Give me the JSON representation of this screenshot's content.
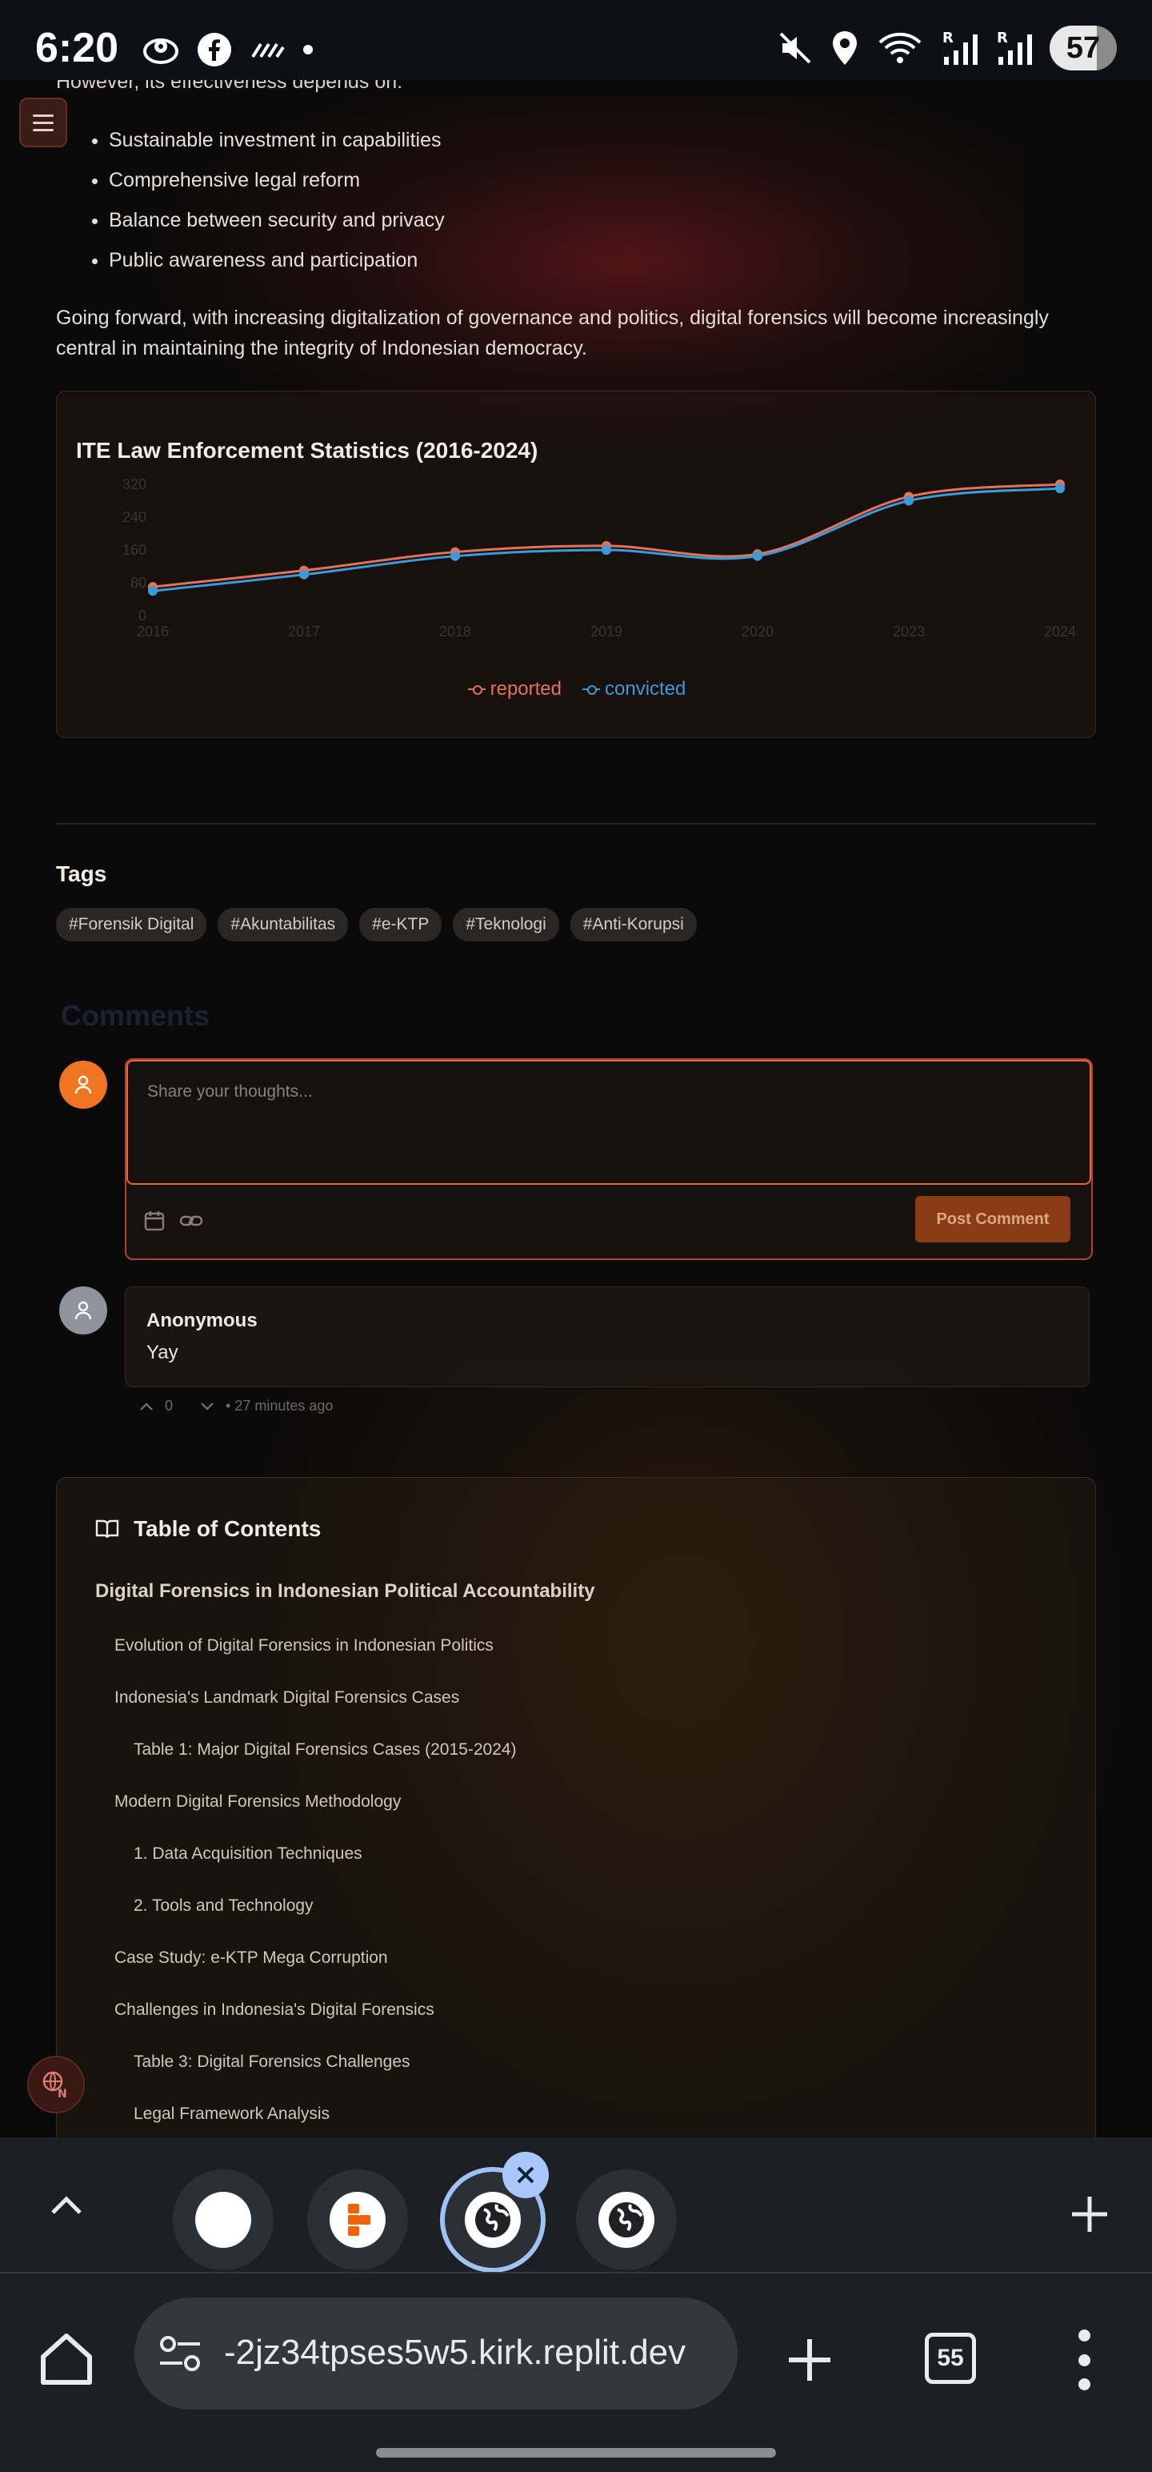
{
  "status_bar": {
    "time": "6:20",
    "battery": "57",
    "icons_left": [
      "location-ring-icon",
      "facebook-icon",
      "signal-lines-icon",
      "dot-icon"
    ],
    "icons_right": [
      "mute-icon",
      "location-pin-icon",
      "wifi-icon",
      "signal-r-icon",
      "signal-r-icon"
    ]
  },
  "article": {
    "intro": "However, its effectiveness depends on:",
    "bullets": [
      "Sustainable investment in capabilities",
      "Comprehensive legal reform",
      "Balance between security and privacy",
      "Public awareness and participation"
    ],
    "paragraph": "Going forward, with increasing digitalization of governance and politics, digital forensics will become increasingly central in maintaining the integrity of Indonesian democracy."
  },
  "chart_data": {
    "type": "line",
    "title": "ITE Law Enforcement Statistics (2016-2024)",
    "x": [
      "2016",
      "2017",
      "2018",
      "2019",
      "2020",
      "2023",
      "2024"
    ],
    "ylim": [
      0,
      320
    ],
    "yticks": [
      0,
      80,
      160,
      240,
      320
    ],
    "series": [
      {
        "name": "reported",
        "color": "#e2735b",
        "values": [
          70,
          110,
          155,
          170,
          150,
          290,
          320
        ]
      },
      {
        "name": "convicted",
        "color": "#3b9ad9",
        "values": [
          60,
          100,
          145,
          160,
          145,
          280,
          310
        ]
      }
    ],
    "legend_position": "bottom"
  },
  "tags": {
    "heading": "Tags",
    "items": [
      "#Forensik Digital",
      "#Akuntabilitas",
      "#e-KTP",
      "#Teknologi",
      "#Anti-Korupsi"
    ]
  },
  "comments": {
    "heading": "Comments",
    "placeholder": "Share your thoughts...",
    "post_label": "Post Comment",
    "list": [
      {
        "author": "Anonymous",
        "body": "Yay",
        "votes": "0",
        "time": "• 27 minutes ago"
      }
    ]
  },
  "toc": {
    "title": "Table of Contents",
    "main": "Digital Forensics in Indonesian Political Accountability",
    "items": [
      {
        "label": "Evolution of Digital Forensics in Indonesian Politics",
        "level": 1
      },
      {
        "label": "Indonesia's Landmark Digital Forensics Cases",
        "level": 1
      },
      {
        "label": "Table 1: Major Digital Forensics Cases (2015-2024)",
        "level": 2
      },
      {
        "label": "Modern Digital Forensics Methodology",
        "level": 1
      },
      {
        "label": "1. Data Acquisition Techniques",
        "level": 2
      },
      {
        "label": "2. Tools and Technology",
        "level": 2
      },
      {
        "label": "Case Study: e-KTP Mega Corruption",
        "level": 1
      },
      {
        "label": "Challenges in Indonesia's Digital Forensics",
        "level": 1
      },
      {
        "label": "Table 3: Digital Forensics Challenges",
        "level": 2
      },
      {
        "label": "Legal Framework Analysis",
        "level": 2
      }
    ]
  },
  "browser": {
    "url": "-2jz34tpses5w5.kirk.replit.dev",
    "tab_count": "55"
  }
}
